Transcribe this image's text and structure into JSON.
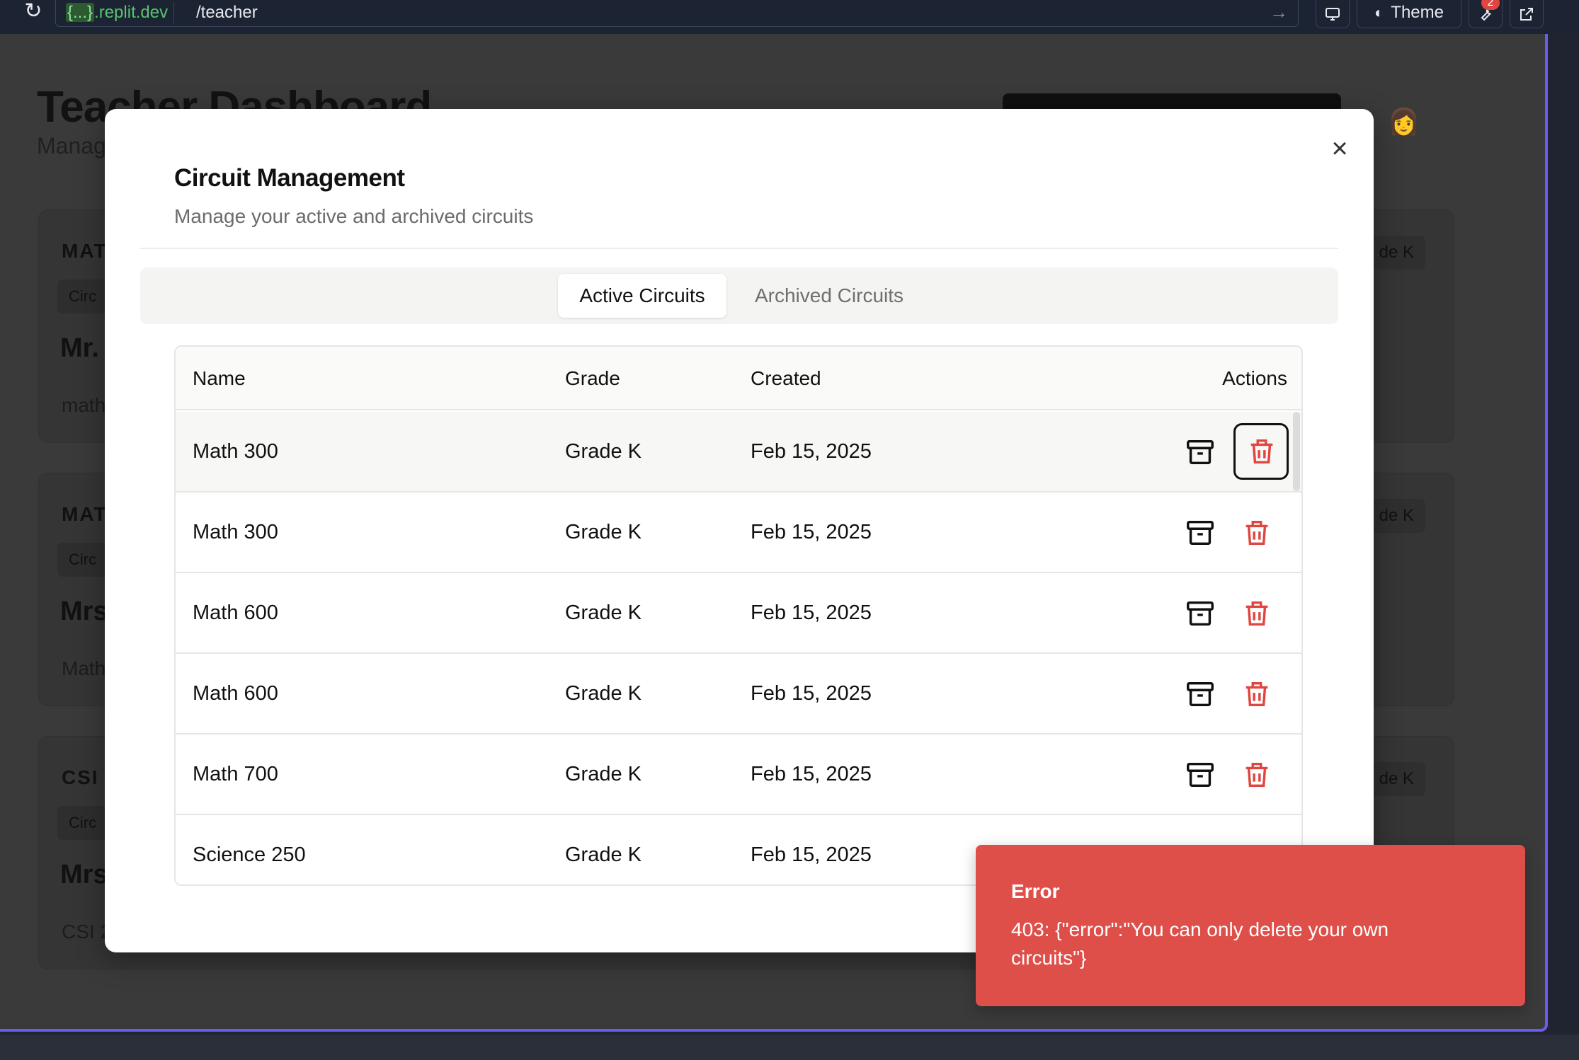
{
  "browser": {
    "url_host_braces": "{...}",
    "url_host_rest": ".replit.dev",
    "url_path": "/teacher",
    "theme_label": "Theme",
    "notification_count": "2"
  },
  "background": {
    "title": "Teacher Dashboard",
    "subtitle": "Manag",
    "cards": [
      {
        "code": "MAT",
        "chip": "Circ",
        "who": "Mr.",
        "desc": "math",
        "grade": "de K"
      },
      {
        "code": "MAT",
        "chip": "Circ",
        "who": "Mrs",
        "desc": "Math",
        "grade": "de K"
      },
      {
        "code": "CSI",
        "chip": "Circ",
        "who": "Mrs",
        "desc": "CSI 2",
        "grade": "de K"
      }
    ]
  },
  "modal": {
    "title": "Circuit Management",
    "description": "Manage your active and archived circuits",
    "close_icon": "×",
    "tabs": [
      {
        "label": "Active Circuits",
        "active": true
      },
      {
        "label": "Archived Circuits",
        "active": false
      }
    ],
    "table": {
      "headers": {
        "name": "Name",
        "grade": "Grade",
        "created": "Created",
        "actions": "Actions"
      },
      "rows": [
        {
          "name": "Math 300",
          "grade": "Grade K",
          "created": "Feb 15, 2025"
        },
        {
          "name": "Math 300",
          "grade": "Grade K",
          "created": "Feb 15, 2025"
        },
        {
          "name": "Math 600",
          "grade": "Grade K",
          "created": "Feb 15, 2025"
        },
        {
          "name": "Math 600",
          "grade": "Grade K",
          "created": "Feb 15, 2025"
        },
        {
          "name": "Math 700",
          "grade": "Grade K",
          "created": "Feb 15, 2025"
        },
        {
          "name": "Science 250",
          "grade": "Grade K",
          "created": "Feb 15, 2025"
        }
      ]
    }
  },
  "toast": {
    "title": "Error",
    "message": "403: {\"error\":\"You can only delete your own circuits\"}"
  },
  "colors": {
    "toast_bg": "#df4f4a",
    "delete_icon": "#e0453f",
    "frame_accent": "#6a5cf0"
  }
}
